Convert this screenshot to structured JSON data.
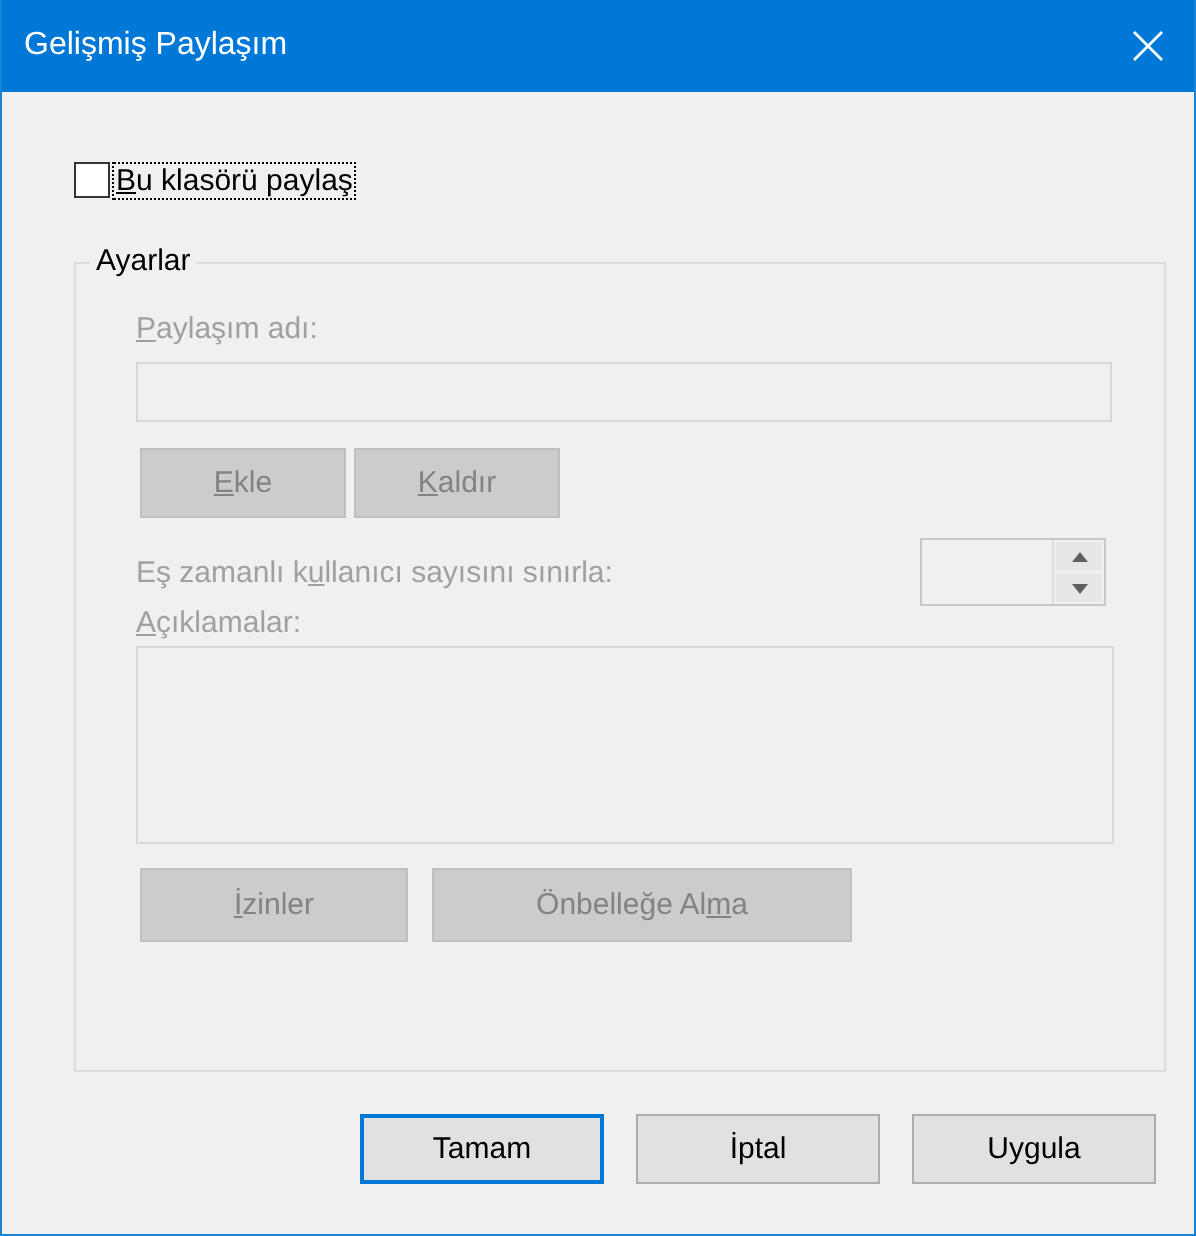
{
  "window": {
    "title": "Gelişmiş Paylaşım"
  },
  "share_checkbox": {
    "label": {
      "key": "B",
      "post": "u klasörü paylaş"
    },
    "checked": false,
    "focused": true
  },
  "settings": {
    "legend": "Ayarlar",
    "disabled": true,
    "share_name": {
      "label": {
        "key": "P",
        "post": "aylaşım adı:"
      }
    },
    "name_buttons": [
      {
        "label": {
          "key": "E",
          "post": "kle"
        }
      },
      {
        "label": {
          "key": "K",
          "post": "aldır"
        }
      }
    ],
    "user_limit": {
      "label": {
        "pre": "Eş zamanlı k",
        "key": "u",
        "post": "llanıcı sayısını sınırla:"
      }
    },
    "comments": {
      "label": {
        "key": "A",
        "post": "çıklamalar:"
      }
    },
    "buttons": [
      {
        "label": {
          "key": "İ",
          "post": "zinler"
        }
      },
      {
        "label": {
          "pre": "Önbelleğe Al",
          "key": "m",
          "post": "a"
        }
      }
    ]
  },
  "footer_buttons": [
    {
      "label": "Tamam",
      "default": true
    },
    {
      "label": "İptal",
      "default": false
    },
    {
      "label": "Uygula",
      "default": false
    }
  ]
}
